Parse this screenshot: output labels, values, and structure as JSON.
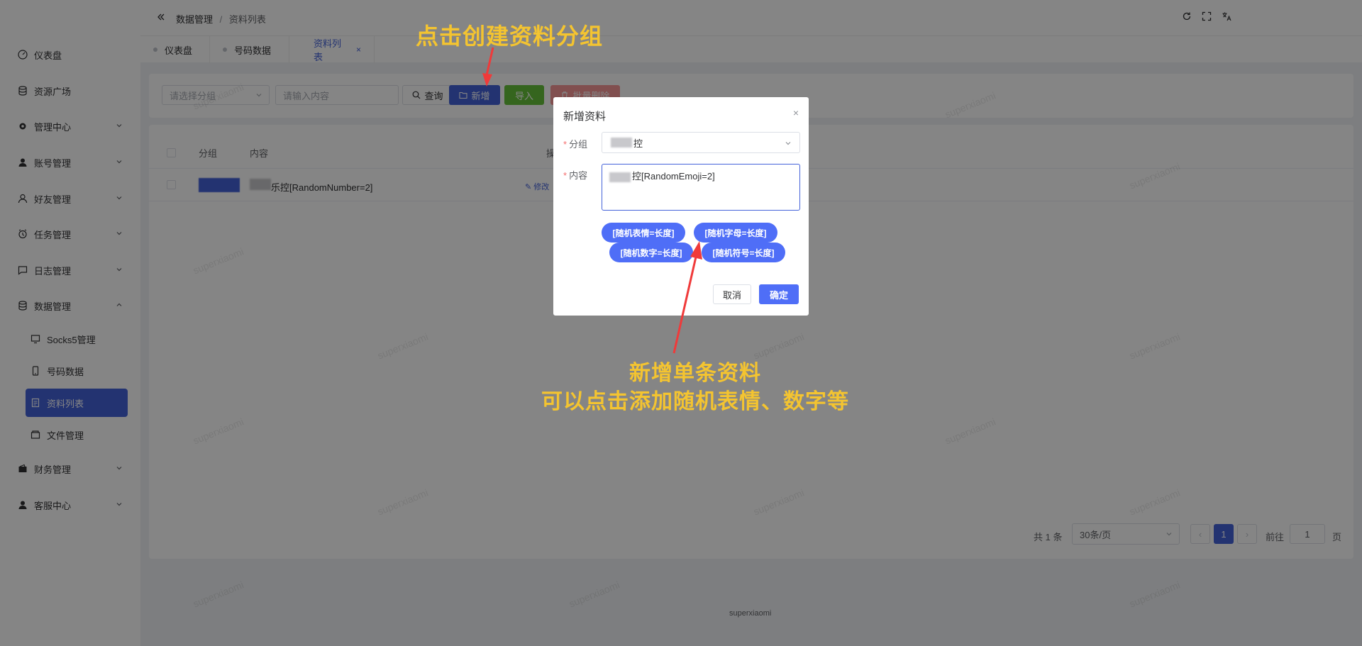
{
  "sidebar": {
    "items": [
      {
        "label": "仪表盘",
        "icon": "dashboard-icon"
      },
      {
        "label": "资源广场",
        "icon": "database-icon"
      },
      {
        "label": "管理中心",
        "icon": "gear-icon"
      },
      {
        "label": "账号管理",
        "icon": "user-icon"
      },
      {
        "label": "好友管理",
        "icon": "user-outline-icon"
      },
      {
        "label": "任务管理",
        "icon": "alarm-icon"
      },
      {
        "label": "日志管理",
        "icon": "chat-icon"
      },
      {
        "label": "数据管理",
        "icon": "database-icon"
      },
      {
        "label": "财务管理",
        "icon": "wallet-icon"
      },
      {
        "label": "客服中心",
        "icon": "user-icon"
      }
    ],
    "sub_items": [
      {
        "label": "Socks5管理",
        "icon": "monitor-icon"
      },
      {
        "label": "号码数据",
        "icon": "phone-icon"
      },
      {
        "label": "资料列表",
        "icon": "document-icon"
      },
      {
        "label": "文件管理",
        "icon": "box-icon"
      }
    ]
  },
  "breadcrumb": {
    "root": "数据管理",
    "sep": "/",
    "current": "资料列表"
  },
  "tabs": [
    {
      "label": "仪表盘"
    },
    {
      "label": "号码数据"
    },
    {
      "label": "资料列表",
      "close": "×"
    }
  ],
  "search": {
    "group_placeholder": "请选择分组",
    "content_placeholder": "请输入内容",
    "query_label": "查询",
    "add_label": "新增",
    "import_label": "导入",
    "batch_delete_label": "批量删除"
  },
  "table": {
    "headers": [
      "分组",
      "内容",
      "操作"
    ],
    "rows": [
      {
        "content_suffix": "乐控[RandomNumber=2]",
        "edit_label": "修改"
      }
    ]
  },
  "pagination": {
    "total": "共 1 条",
    "page_size": "30条/页",
    "current_page": "1",
    "goto_label": "前往",
    "goto_value": "1",
    "page_unit": "页",
    "prev": "‹",
    "next": "›"
  },
  "footer": {
    "text": "superxiaomi"
  },
  "watermark": "superxiaomi",
  "modal": {
    "title": "新增资料",
    "close": "×",
    "group_label": "分组",
    "group_value": "控",
    "content_label": "内容",
    "content_value": "控[RandomEmoji=2]",
    "chips": [
      "[随机表情=长度]",
      "[随机字母=长度]",
      "[随机数字=长度]",
      "[随机符号=长度]"
    ],
    "cancel_label": "取消",
    "confirm_label": "确定"
  },
  "annotations": {
    "top": "点击创建资料分组",
    "bottom_line1": "新增单条资料",
    "bottom_line2": "可以点击添加随机表情、数字等"
  },
  "colors": {
    "primary": "#4462d9",
    "chip": "#4f6ef7",
    "success": "#67c23a",
    "danger": "#f56c6c",
    "annotation": "#f4c430",
    "arrow": "#f03a3a"
  }
}
